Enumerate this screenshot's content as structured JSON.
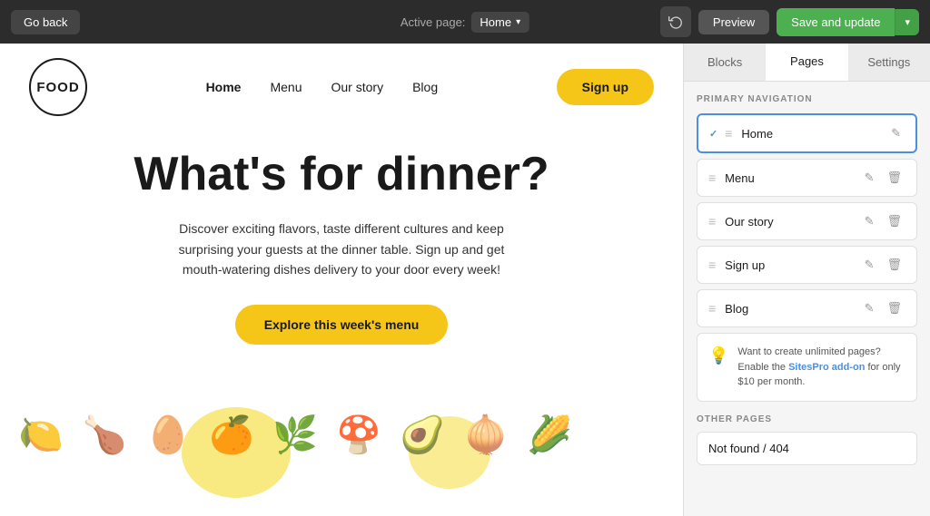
{
  "topbar": {
    "go_back_label": "Go back",
    "active_page_prefix": "Active page:",
    "active_page_name": "Home",
    "history_icon": "⟳",
    "preview_label": "Preview",
    "save_update_label": "Save and update",
    "arrow_icon": "▾"
  },
  "site": {
    "logo_text": "FOOD",
    "nav_links": [
      "Home",
      "Menu",
      "Our story",
      "Blog"
    ],
    "signup_label": "Sign up",
    "hero_title": "What's for dinner?",
    "hero_subtitle": "Discover exciting flavors, taste different cultures and keep surprising your guests at the dinner table. Sign up and get mouth-watering dishes delivery to your door every week!",
    "explore_btn_label": "Explore this week's menu"
  },
  "panel": {
    "tabs": [
      "Blocks",
      "Pages",
      "Settings"
    ],
    "active_tab": "Pages",
    "primary_nav_label": "PRIMARY NAVIGATION",
    "nav_items": [
      {
        "name": "Home",
        "active": true
      },
      {
        "name": "Menu",
        "active": false
      },
      {
        "name": "Our story",
        "active": false
      },
      {
        "name": "Sign up",
        "active": false
      },
      {
        "name": "Blog",
        "active": false
      }
    ],
    "promo_text": "Want to create unlimited pages? Enable the ",
    "promo_link_text": "SitesPro add-on",
    "promo_text2": " for only $10 per month.",
    "other_pages_label": "OTHER PAGES",
    "other_page_item": "Not found / 404"
  }
}
